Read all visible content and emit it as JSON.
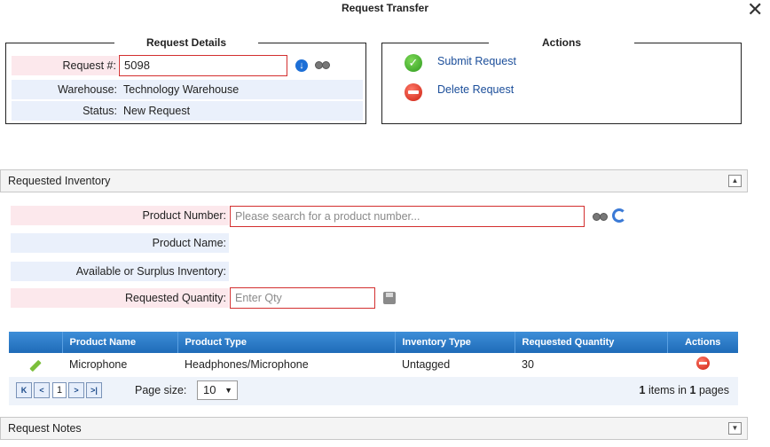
{
  "window": {
    "title": "Request Transfer",
    "close_symbol": "✕"
  },
  "request_details": {
    "legend": "Request Details",
    "request_label": "Request #:",
    "request_value": "5098",
    "warehouse_label": "Warehouse:",
    "warehouse_value": "Technology Warehouse",
    "status_label": "Status:",
    "status_value": "New Request"
  },
  "actions": {
    "legend": "Actions",
    "submit_label": "Submit Request",
    "delete_label": "Delete Request"
  },
  "requested_inventory": {
    "title": "Requested Inventory",
    "collapse_symbol": "▲",
    "product_number_label": "Product Number:",
    "product_number_placeholder": "Please search for a product number...",
    "product_name_label": "Product Name:",
    "available_label": "Available or Surplus Inventory:",
    "requested_qty_label": "Requested Quantity:",
    "requested_qty_placeholder": "Enter Qty"
  },
  "grid": {
    "columns": [
      "",
      "Product Name",
      "Product Type",
      "Inventory Type",
      "Requested Quantity",
      "Actions"
    ],
    "rows": [
      {
        "product_name": "Microphone",
        "product_type": "Headphones/Microphone",
        "inventory_type": "Untagged",
        "requested_quantity": "30"
      }
    ]
  },
  "pager": {
    "first": "K",
    "prev": "<",
    "page": "1",
    "next": ">",
    "last": ">|",
    "page_size_label": "Page size:",
    "page_size_value": "10",
    "items_count": "1",
    "items_text": "items in",
    "pages_count": "1",
    "pages_text": "pages"
  },
  "request_notes": {
    "title": "Request Notes",
    "expand_symbol": "▼"
  }
}
